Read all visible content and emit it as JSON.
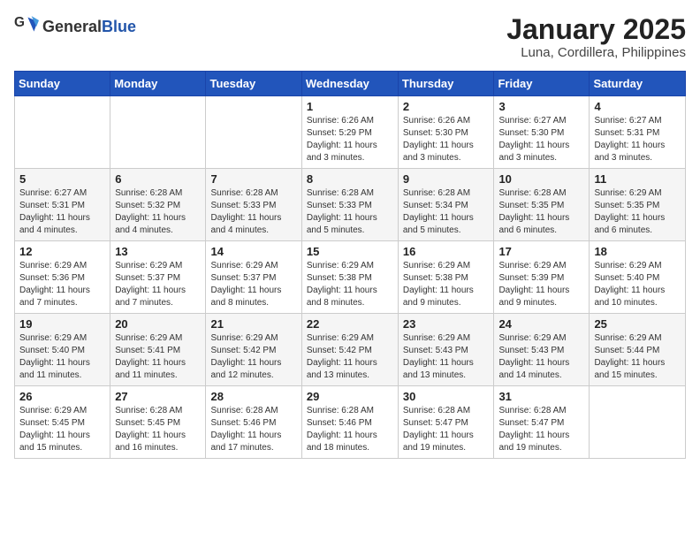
{
  "header": {
    "logo_general": "General",
    "logo_blue": "Blue",
    "month_title": "January 2025",
    "location": "Luna, Cordillera, Philippines"
  },
  "days_of_week": [
    "Sunday",
    "Monday",
    "Tuesday",
    "Wednesday",
    "Thursday",
    "Friday",
    "Saturday"
  ],
  "weeks": [
    [
      {
        "day": "",
        "sunrise": "",
        "sunset": "",
        "daylight": ""
      },
      {
        "day": "",
        "sunrise": "",
        "sunset": "",
        "daylight": ""
      },
      {
        "day": "",
        "sunrise": "",
        "sunset": "",
        "daylight": ""
      },
      {
        "day": "1",
        "sunrise": "Sunrise: 6:26 AM",
        "sunset": "Sunset: 5:29 PM",
        "daylight": "Daylight: 11 hours and 3 minutes."
      },
      {
        "day": "2",
        "sunrise": "Sunrise: 6:26 AM",
        "sunset": "Sunset: 5:30 PM",
        "daylight": "Daylight: 11 hours and 3 minutes."
      },
      {
        "day": "3",
        "sunrise": "Sunrise: 6:27 AM",
        "sunset": "Sunset: 5:30 PM",
        "daylight": "Daylight: 11 hours and 3 minutes."
      },
      {
        "day": "4",
        "sunrise": "Sunrise: 6:27 AM",
        "sunset": "Sunset: 5:31 PM",
        "daylight": "Daylight: 11 hours and 3 minutes."
      }
    ],
    [
      {
        "day": "5",
        "sunrise": "Sunrise: 6:27 AM",
        "sunset": "Sunset: 5:31 PM",
        "daylight": "Daylight: 11 hours and 4 minutes."
      },
      {
        "day": "6",
        "sunrise": "Sunrise: 6:28 AM",
        "sunset": "Sunset: 5:32 PM",
        "daylight": "Daylight: 11 hours and 4 minutes."
      },
      {
        "day": "7",
        "sunrise": "Sunrise: 6:28 AM",
        "sunset": "Sunset: 5:33 PM",
        "daylight": "Daylight: 11 hours and 4 minutes."
      },
      {
        "day": "8",
        "sunrise": "Sunrise: 6:28 AM",
        "sunset": "Sunset: 5:33 PM",
        "daylight": "Daylight: 11 hours and 5 minutes."
      },
      {
        "day": "9",
        "sunrise": "Sunrise: 6:28 AM",
        "sunset": "Sunset: 5:34 PM",
        "daylight": "Daylight: 11 hours and 5 minutes."
      },
      {
        "day": "10",
        "sunrise": "Sunrise: 6:28 AM",
        "sunset": "Sunset: 5:35 PM",
        "daylight": "Daylight: 11 hours and 6 minutes."
      },
      {
        "day": "11",
        "sunrise": "Sunrise: 6:29 AM",
        "sunset": "Sunset: 5:35 PM",
        "daylight": "Daylight: 11 hours and 6 minutes."
      }
    ],
    [
      {
        "day": "12",
        "sunrise": "Sunrise: 6:29 AM",
        "sunset": "Sunset: 5:36 PM",
        "daylight": "Daylight: 11 hours and 7 minutes."
      },
      {
        "day": "13",
        "sunrise": "Sunrise: 6:29 AM",
        "sunset": "Sunset: 5:37 PM",
        "daylight": "Daylight: 11 hours and 7 minutes."
      },
      {
        "day": "14",
        "sunrise": "Sunrise: 6:29 AM",
        "sunset": "Sunset: 5:37 PM",
        "daylight": "Daylight: 11 hours and 8 minutes."
      },
      {
        "day": "15",
        "sunrise": "Sunrise: 6:29 AM",
        "sunset": "Sunset: 5:38 PM",
        "daylight": "Daylight: 11 hours and 8 minutes."
      },
      {
        "day": "16",
        "sunrise": "Sunrise: 6:29 AM",
        "sunset": "Sunset: 5:38 PM",
        "daylight": "Daylight: 11 hours and 9 minutes."
      },
      {
        "day": "17",
        "sunrise": "Sunrise: 6:29 AM",
        "sunset": "Sunset: 5:39 PM",
        "daylight": "Daylight: 11 hours and 9 minutes."
      },
      {
        "day": "18",
        "sunrise": "Sunrise: 6:29 AM",
        "sunset": "Sunset: 5:40 PM",
        "daylight": "Daylight: 11 hours and 10 minutes."
      }
    ],
    [
      {
        "day": "19",
        "sunrise": "Sunrise: 6:29 AM",
        "sunset": "Sunset: 5:40 PM",
        "daylight": "Daylight: 11 hours and 11 minutes."
      },
      {
        "day": "20",
        "sunrise": "Sunrise: 6:29 AM",
        "sunset": "Sunset: 5:41 PM",
        "daylight": "Daylight: 11 hours and 11 minutes."
      },
      {
        "day": "21",
        "sunrise": "Sunrise: 6:29 AM",
        "sunset": "Sunset: 5:42 PM",
        "daylight": "Daylight: 11 hours and 12 minutes."
      },
      {
        "day": "22",
        "sunrise": "Sunrise: 6:29 AM",
        "sunset": "Sunset: 5:42 PM",
        "daylight": "Daylight: 11 hours and 13 minutes."
      },
      {
        "day": "23",
        "sunrise": "Sunrise: 6:29 AM",
        "sunset": "Sunset: 5:43 PM",
        "daylight": "Daylight: 11 hours and 13 minutes."
      },
      {
        "day": "24",
        "sunrise": "Sunrise: 6:29 AM",
        "sunset": "Sunset: 5:43 PM",
        "daylight": "Daylight: 11 hours and 14 minutes."
      },
      {
        "day": "25",
        "sunrise": "Sunrise: 6:29 AM",
        "sunset": "Sunset: 5:44 PM",
        "daylight": "Daylight: 11 hours and 15 minutes."
      }
    ],
    [
      {
        "day": "26",
        "sunrise": "Sunrise: 6:29 AM",
        "sunset": "Sunset: 5:45 PM",
        "daylight": "Daylight: 11 hours and 15 minutes."
      },
      {
        "day": "27",
        "sunrise": "Sunrise: 6:28 AM",
        "sunset": "Sunset: 5:45 PM",
        "daylight": "Daylight: 11 hours and 16 minutes."
      },
      {
        "day": "28",
        "sunrise": "Sunrise: 6:28 AM",
        "sunset": "Sunset: 5:46 PM",
        "daylight": "Daylight: 11 hours and 17 minutes."
      },
      {
        "day": "29",
        "sunrise": "Sunrise: 6:28 AM",
        "sunset": "Sunset: 5:46 PM",
        "daylight": "Daylight: 11 hours and 18 minutes."
      },
      {
        "day": "30",
        "sunrise": "Sunrise: 6:28 AM",
        "sunset": "Sunset: 5:47 PM",
        "daylight": "Daylight: 11 hours and 19 minutes."
      },
      {
        "day": "31",
        "sunrise": "Sunrise: 6:28 AM",
        "sunset": "Sunset: 5:47 PM",
        "daylight": "Daylight: 11 hours and 19 minutes."
      },
      {
        "day": "",
        "sunrise": "",
        "sunset": "",
        "daylight": ""
      }
    ]
  ]
}
